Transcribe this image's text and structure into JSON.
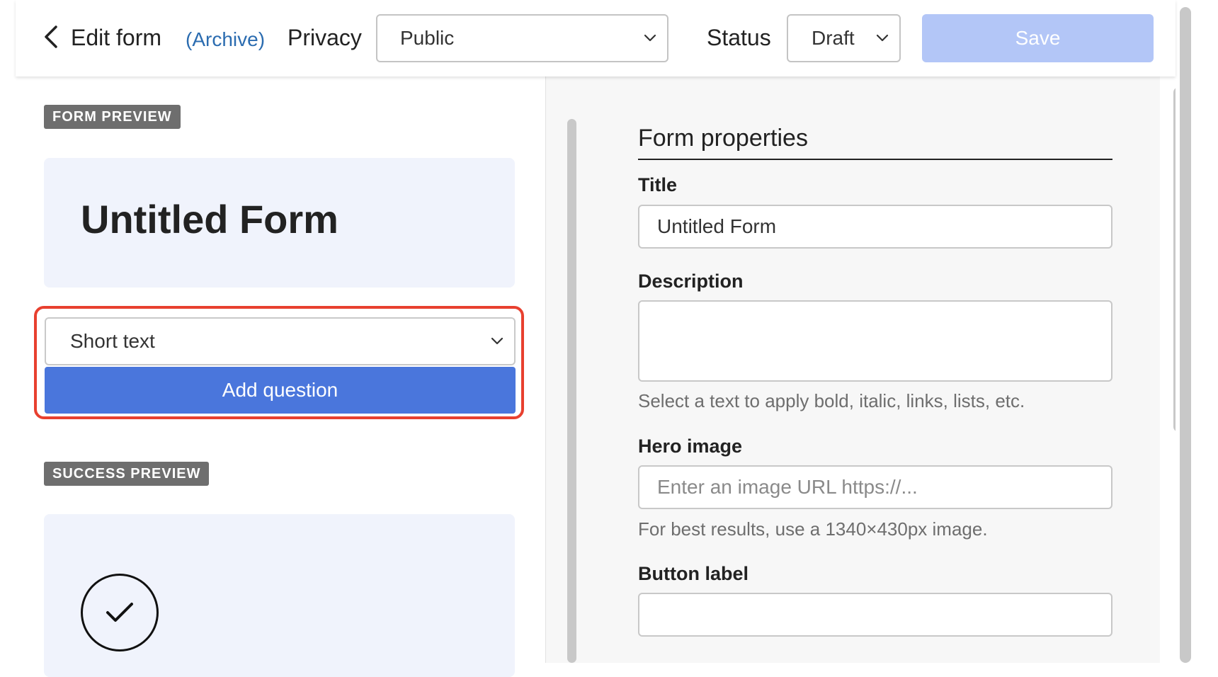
{
  "header": {
    "title": "Edit form",
    "archive_link": "(Archive)",
    "privacy_label": "Privacy",
    "privacy_value": "Public",
    "status_label": "Status",
    "status_value": "Draft",
    "save_label": "Save"
  },
  "left": {
    "form_preview_tag": "FORM PREVIEW",
    "preview_title": "Untitled Form",
    "question_type_value": "Short text",
    "add_question_label": "Add question",
    "success_preview_tag": "SUCCESS PREVIEW"
  },
  "right": {
    "heading": "Form properties",
    "title_label": "Title",
    "title_value": "Untitled Form",
    "description_label": "Description",
    "description_value": "",
    "description_help": "Select a text to apply bold, italic, links, lists, etc.",
    "hero_label": "Hero image",
    "hero_placeholder": "Enter an image URL https://...",
    "hero_help": "For best results, use a 1340×430px image.",
    "button_label": "Button label"
  },
  "colors": {
    "accent": "#4a76dc",
    "save_disabled": "#b3c6f7",
    "highlight": "#e8402f",
    "link": "#2b6cb0",
    "tag_bg": "#6e6e6e",
    "card_bg": "#f0f3fc"
  },
  "icons": {
    "back": "chevron-left-icon",
    "dropdown": "chevron-down-icon",
    "success": "checkmark-circle-icon"
  }
}
